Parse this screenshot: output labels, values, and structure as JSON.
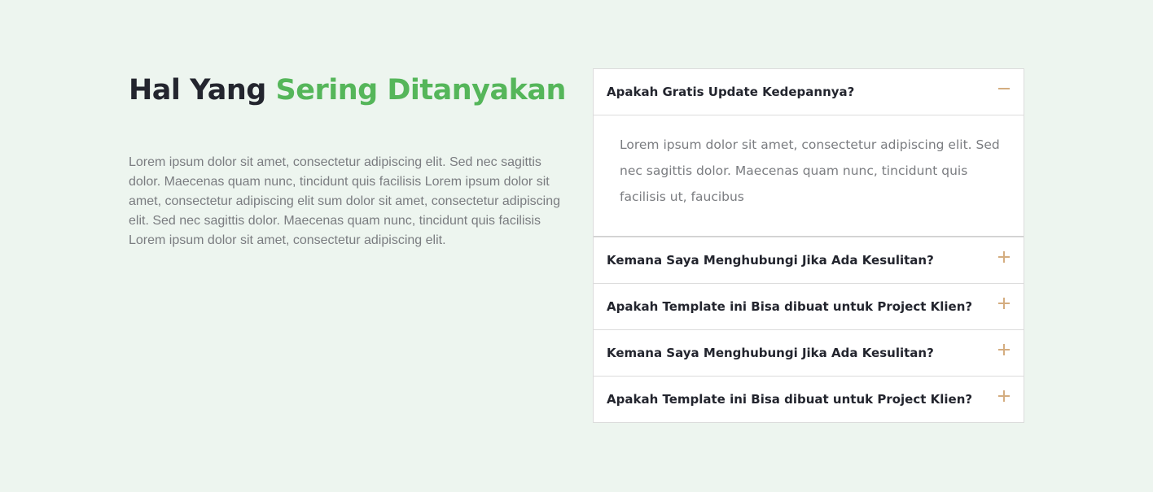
{
  "heading": {
    "part1": "Hal Yang",
    "part2": "Sering Ditanyakan"
  },
  "description": "Lorem ipsum dolor sit amet, consectetur adipiscing elit. Sed nec sagittis dolor. Maecenas quam nunc, tincidunt quis facilisis Lorem ipsum dolor sit amet, consectetur adipiscing elit sum dolor sit amet, consectetur adipiscing elit. Sed nec sagittis dolor. Maecenas quam nunc, tincidunt quis facilisis Lorem ipsum dolor sit amet, consectetur adipiscing elit.",
  "faq": [
    {
      "question": "Apakah Gratis Update Kedepannya?",
      "answer": "Lorem ipsum dolor sit amet, consectetur adipiscing elit. Sed nec sagittis dolor. Maecenas quam nunc, tincidunt quis facilisis ut, faucibus",
      "expanded": true,
      "icon": "minus-icon"
    },
    {
      "question": "Kemana Saya Menghubungi Jika Ada Kesulitan?",
      "expanded": false,
      "icon": "plus-icon"
    },
    {
      "question": "Apakah Template ini Bisa dibuat untuk Project Klien?",
      "expanded": false,
      "icon": "plus-icon"
    },
    {
      "question": "Kemana Saya Menghubungi Jika Ada Kesulitan?",
      "expanded": false,
      "icon": "plus-icon"
    },
    {
      "question": "Apakah Template ini Bisa dibuat untuk Project Klien?",
      "expanded": false,
      "icon": "plus-icon"
    }
  ],
  "colors": {
    "background": "#edf5ef",
    "heading_dark": "#23252e",
    "heading_accent": "#55b65a",
    "icon_accent": "#d4ad80",
    "body_text": "#7a7c80"
  }
}
